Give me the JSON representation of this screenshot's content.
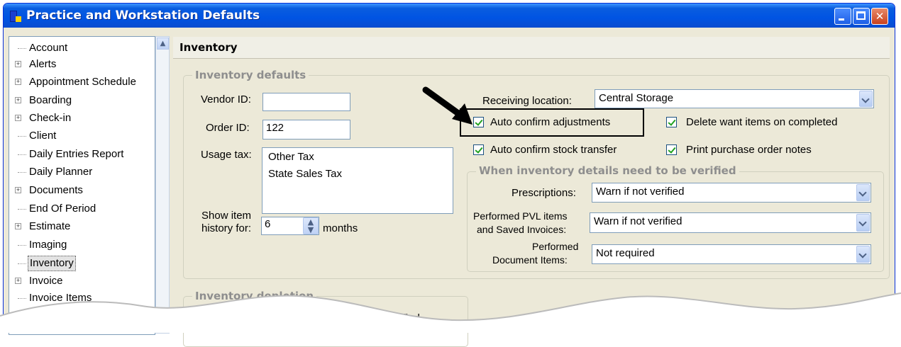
{
  "window": {
    "title": "Practice and Workstation Defaults",
    "accent": "#0054e3"
  },
  "tree": {
    "items": [
      {
        "label": "Account",
        "expandable": false
      },
      {
        "label": "Alerts",
        "expandable": true
      },
      {
        "label": "Appointment Schedule",
        "expandable": true
      },
      {
        "label": "Boarding",
        "expandable": true
      },
      {
        "label": "Check-in",
        "expandable": true
      },
      {
        "label": "Client",
        "expandable": false
      },
      {
        "label": "Daily Entries Report",
        "expandable": false
      },
      {
        "label": "Daily Planner",
        "expandable": false
      },
      {
        "label": "Documents",
        "expandable": true
      },
      {
        "label": "End Of Period",
        "expandable": false
      },
      {
        "label": "Estimate",
        "expandable": true
      },
      {
        "label": "Imaging",
        "expandable": false
      },
      {
        "label": "Inventory",
        "expandable": false,
        "selected": true
      },
      {
        "label": "Invoice",
        "expandable": true
      },
      {
        "label": "Invoice Items",
        "expandable": false
      }
    ]
  },
  "panel": {
    "title": "Inventory",
    "defaults_group": "Inventory defaults",
    "vendor_id_label": "Vendor ID:",
    "vendor_id_value": "",
    "order_id_label": "Order ID:",
    "order_id_value": "122",
    "usage_tax_label": "Usage tax:",
    "usage_tax_items": [
      "Other Tax",
      "State Sales Tax"
    ],
    "show_item_label_1": "Show item",
    "show_item_label_2": "history for:",
    "history_value": "6",
    "months_label": "months",
    "receiving_location_label": "Receiving location:",
    "receiving_location_value": "Central Storage",
    "auto_confirm_adjustments": "Auto confirm adjustments",
    "delete_want_items": "Delete want items on completed",
    "auto_confirm_stock_transfer": "Auto confirm stock transfer",
    "print_po_notes": "Print purchase order notes",
    "verify_group": "When inventory details need to be verified",
    "prescriptions_label": "Prescriptions:",
    "prescriptions_value": "Warn if not verified",
    "pvl_label_1": "Performed PVL items",
    "pvl_label_2": "and Saved Invoices:",
    "pvl_value": "Warn if not verified",
    "doc_label_1": "Performed",
    "doc_label_2": "Document Items:",
    "doc_value": "Not required",
    "depletion_group": "Inventory depletion",
    "depletion_text": "Automatically mark inventory details as verified"
  }
}
